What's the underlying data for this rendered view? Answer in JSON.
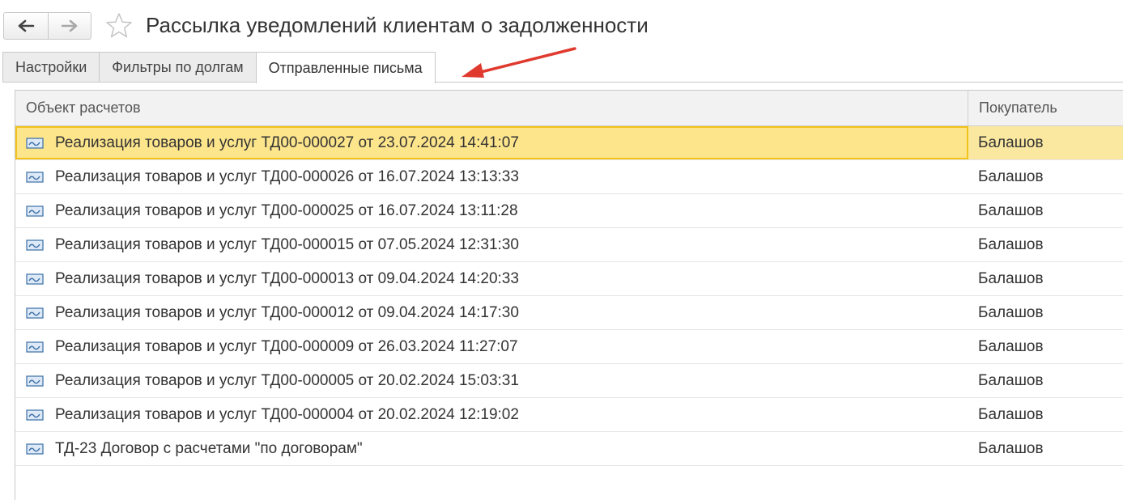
{
  "window": {
    "title": "Рассылка уведомлений клиентам о задолженности",
    "back_icon": "arrow-left-icon",
    "forward_icon": "arrow-right-icon",
    "favorite_icon": "star-icon"
  },
  "tabs": [
    {
      "label": "Настройки",
      "active": false
    },
    {
      "label": "Фильтры по долгам",
      "active": false
    },
    {
      "label": "Отправленные письма",
      "active": true
    }
  ],
  "annotation": {
    "color": "#e03a2f"
  },
  "table": {
    "columns": [
      "Объект расчетов",
      "Покупатель"
    ],
    "row_icon": "document-icon",
    "selected_index": 0,
    "rows": [
      {
        "object": "Реализация товаров и услуг ТД00-000027 от 23.07.2024 14:41:07",
        "buyer": "Балашов"
      },
      {
        "object": "Реализация товаров и услуг ТД00-000026 от 16.07.2024 13:13:33",
        "buyer": "Балашов"
      },
      {
        "object": "Реализация товаров и услуг ТД00-000025 от 16.07.2024 13:11:28",
        "buyer": "Балашов"
      },
      {
        "object": "Реализация товаров и услуг ТД00-000015 от 07.05.2024 12:31:30",
        "buyer": "Балашов"
      },
      {
        "object": "Реализация товаров и услуг ТД00-000013 от 09.04.2024 14:20:33",
        "buyer": "Балашов"
      },
      {
        "object": "Реализация товаров и услуг ТД00-000012 от 09.04.2024 14:17:30",
        "buyer": "Балашов"
      },
      {
        "object": "Реализация товаров и услуг ТД00-000009 от 26.03.2024 11:27:07",
        "buyer": "Балашов"
      },
      {
        "object": "Реализация товаров и услуг ТД00-000005 от 20.02.2024 15:03:31",
        "buyer": "Балашов"
      },
      {
        "object": "Реализация товаров и услуг ТД00-000004 от 20.02.2024 12:19:02",
        "buyer": "Балашов"
      },
      {
        "object": "ТД-23 Договор с расчетами \"по договорам\"",
        "buyer": "Балашов"
      }
    ]
  },
  "colors": {
    "selection": "#fde58c",
    "selection_border": "#f3c21b",
    "icon": "#3a6ea5"
  }
}
